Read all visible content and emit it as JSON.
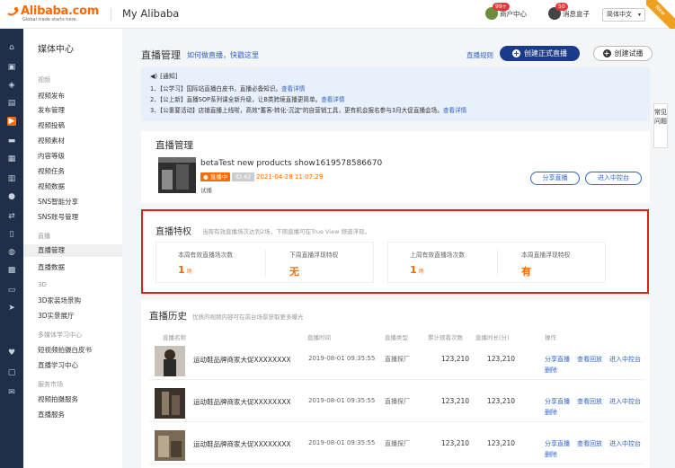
{
  "topbar": {
    "logo_text": "Alibaba.com",
    "logo_tagline": "Global trade starts here.",
    "title": "My Alibaba",
    "user_center_label": "商户中心",
    "user_badge": "99+",
    "message_label": "消息盒子",
    "message_badge": "50",
    "language": "简体中文",
    "ribbon": "New"
  },
  "sidebar": {
    "title": "媒体中心",
    "groups": [
      {
        "label": "视频",
        "items": [
          "视频发布",
          "发布管理",
          "视频投稿",
          "视频素材",
          "内容等级",
          "视频任务",
          "视频数据",
          "SNS智能分享",
          "SNS账号管理"
        ]
      },
      {
        "label": "直播",
        "items": [
          "直播管理",
          "直播数据"
        ]
      },
      {
        "label": "3D",
        "items": [
          "3D家装场景购",
          "3D实景展厅"
        ]
      },
      {
        "label": "多媒体学习中心",
        "items": [
          "短视频拍摄白皮书",
          "直播学习中心"
        ]
      },
      {
        "label": "服务市场",
        "items": [
          "视频拍摄服务",
          "直播服务"
        ]
      }
    ],
    "active_item": "直播管理"
  },
  "header": {
    "title": "直播管理",
    "guide_link": "如何做直播，快戳这里",
    "rules_link": "直播规则",
    "create_live": "创建正式直播",
    "create_trial": "创建试播"
  },
  "notice": {
    "head": "[通知]",
    "lines": [
      {
        "text": "1、【公学习】国际站直播白皮书，直播必备知识。",
        "link": "查看详情"
      },
      {
        "text": "2、【公上新】直播SOP系列课全新升级，让B类跨境直播更简单。",
        "link": "查看详情"
      },
      {
        "text": "3、【公重要活动】店铺直播上线啦，高效\"蓄客-转化-沉淀\"的自营销工具，更有机会报名参与3月大促直播会场。",
        "link": "查看详情"
      }
    ]
  },
  "help_tab": "常见问题",
  "live_manage": {
    "title": "直播管理",
    "name": "betaTest new products show1619578586670",
    "status": "● 直播中",
    "id_tag": "ID:42",
    "time": "2021-04-28 11:07:29",
    "tag": "试播",
    "share_btn": "分享直播",
    "console_btn": "进入中控台"
  },
  "privilege": {
    "title": "直播特权",
    "desc": "当周有效直播场次达到2场，下周直播可在True View 频道浮现。",
    "this_week_count_label": "本周有效直播场次数",
    "this_week_count": "1",
    "count_unit": "场",
    "next_week_float_label": "下周直播浮现特权",
    "next_week_float": "无",
    "last_week_count_label": "上周有效直播场次数",
    "last_week_count": "1",
    "this_week_float_label": "本周直播浮现特权",
    "this_week_float": "有"
  },
  "history": {
    "title": "直播历史",
    "desc": "优质的视频内容可在前台场景获取更多曝光",
    "columns": [
      "直播名称",
      "直播时间",
      "直播类型",
      "累计观看次数",
      "直播时长(分)",
      "操作"
    ],
    "rows": [
      {
        "name": "运动鞋品牌商家大促XXXXXXXX",
        "time": "2019-08-01 09:35:55",
        "type": "直播探厂",
        "views": "123,210",
        "duration": "123,210"
      },
      {
        "name": "运动鞋品牌商家大促XXXXXXXX",
        "time": "2019-08-01 09:35:55",
        "type": "直播探厂",
        "views": "123,210",
        "duration": "123,210"
      },
      {
        "name": "运动鞋品牌商家大促XXXXXXXX",
        "time": "2019-08-01 09:35:55",
        "type": "直播探厂",
        "views": "123,210",
        "duration": "123,210"
      }
    ],
    "ops": {
      "share": "分享直播",
      "replay": "查看回放",
      "console": "进入中控台",
      "delete": "删除"
    }
  }
}
